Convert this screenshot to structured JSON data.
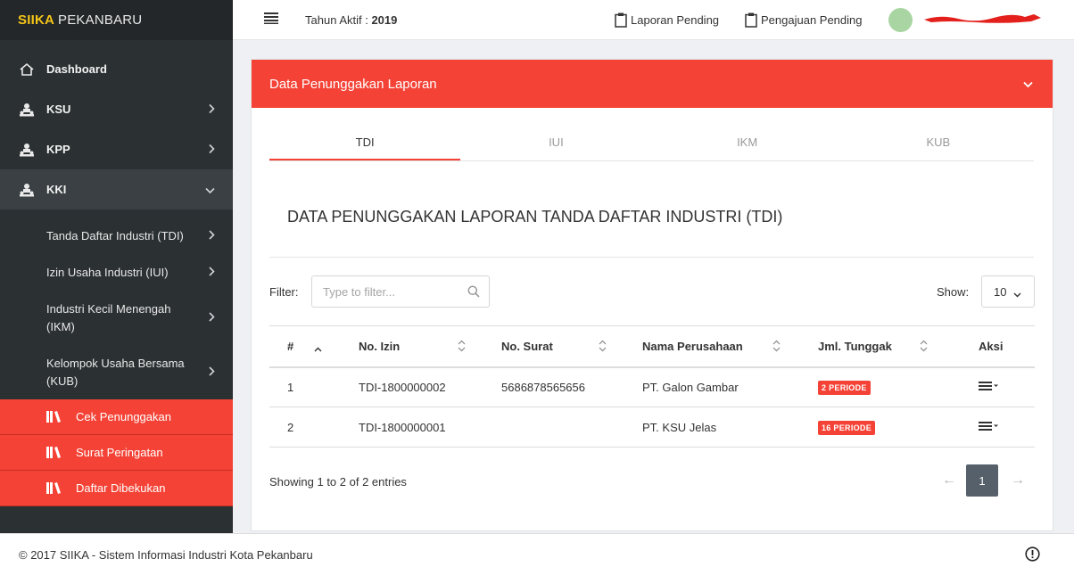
{
  "brand": {
    "part1": "SIIKA",
    "part2": "PEKANBARU"
  },
  "sidebar": {
    "items": [
      {
        "label": "Dashboard",
        "icon": "home-icon"
      },
      {
        "label": "KSU",
        "icon": "user-group-icon"
      },
      {
        "label": "KPP",
        "icon": "user-group-icon"
      },
      {
        "label": "KKI",
        "icon": "user-group-icon"
      }
    ],
    "kki_sub": [
      {
        "label": "Tanda Daftar Industri (TDI)"
      },
      {
        "label": "Izin Usaha Industri (IUI)"
      },
      {
        "label": "Industri Kecil Menengah (IKM)"
      },
      {
        "label": "Kelompok Usaha Bersama (KUB)"
      }
    ],
    "tdi_sub": [
      {
        "label": "Cek Penunggakan",
        "icon": "books-icon"
      },
      {
        "label": "Surat Peringatan",
        "icon": "books-icon"
      },
      {
        "label": "Daftar Dibekukan",
        "icon": "books-icon"
      }
    ]
  },
  "topbar": {
    "tahun_label": "Tahun Aktif :",
    "tahun_value": "2019",
    "laporan_pending": "Laporan Pending",
    "pengajuan_pending": "Pengajuan Pending"
  },
  "panel": {
    "title": "Data Penunggakan Laporan",
    "tabs": [
      "TDI",
      "IUI",
      "IKM",
      "KUB"
    ],
    "active_tab": "TDI",
    "section_title": "DATA PENUNGGAKAN LAPORAN TANDA DAFTAR INDUSTRI (TDI)",
    "filter_label": "Filter:",
    "filter_placeholder": "Type to filter...",
    "show_label": "Show:",
    "show_value": "10",
    "columns": [
      "#",
      "No. Izin",
      "No. Surat",
      "Nama Perusahaan",
      "Jml. Tunggak",
      "Aksi"
    ],
    "rows": [
      {
        "num": "1",
        "no_izin": "TDI-1800000002",
        "no_surat": "5686878565656",
        "nama": "PT. Galon Gambar",
        "tunggak": "2 PERIODE"
      },
      {
        "num": "2",
        "no_izin": "TDI-1800000001",
        "no_surat": "",
        "nama": "PT. KSU Jelas",
        "tunggak": "16 PERIODE"
      }
    ],
    "showing": "Showing 1 to 2 of 2 entries",
    "pagination": {
      "prev": "←",
      "current": "1",
      "next": "→"
    }
  },
  "footer": {
    "text": "© 2017 SIIKA - Sistem Informasi Industri Kota Pekanbaru"
  },
  "colors": {
    "accent": "#f44336",
    "sidebar": "#2b3033",
    "brand_yellow": "#f5c518"
  }
}
